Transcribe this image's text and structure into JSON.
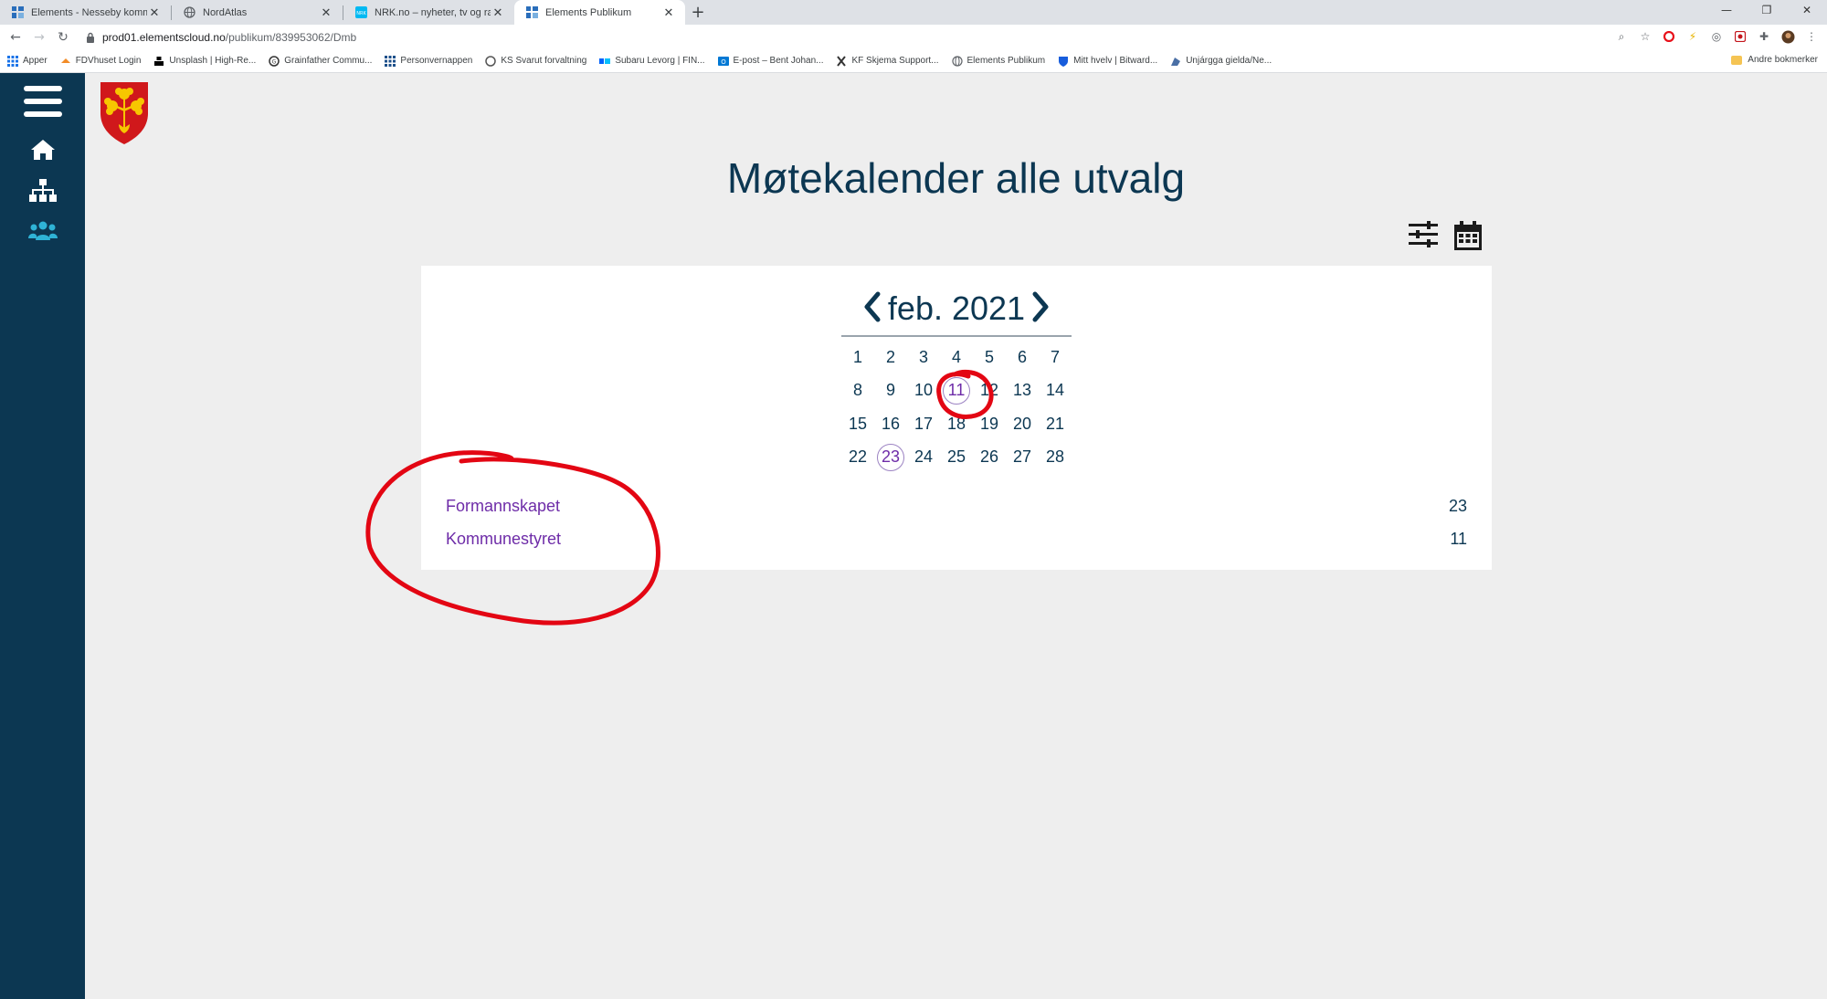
{
  "browser": {
    "tabs": [
      {
        "title": "Elements - Nesseby kommune",
        "active": false,
        "favicon": "elements-icon"
      },
      {
        "title": "NordAtlas",
        "active": false,
        "favicon": "globe-icon"
      },
      {
        "title": "NRK.no – nyheter, tv og radio fra",
        "active": false,
        "favicon": "nrk-icon"
      },
      {
        "title": "Elements Publikum",
        "active": true,
        "favicon": "elements-icon"
      }
    ],
    "url_host": "prod01.elementscloud.no",
    "url_path": "/publikum/839953062/Dmb",
    "bookmarks": [
      "Apper",
      "FDVhuset Login",
      "Unsplash | High-Re...",
      "Grainfather Commu...",
      "Personvernappen",
      "KS Svarut forvaltning",
      "Subaru Levorg | FIN...",
      "E-post – Bent Johan...",
      "KF Skjema Support...",
      "Elements Publikum",
      "Mitt hvelv | Bitward...",
      "Unjárgga gielda/Ne..."
    ],
    "other_bookmarks": "Andre bokmerker"
  },
  "page": {
    "title": "Møtekalender alle utvalg",
    "month_label": "feb. 2021",
    "days": [
      1,
      2,
      3,
      4,
      5,
      6,
      7,
      8,
      9,
      10,
      11,
      12,
      13,
      14,
      15,
      16,
      17,
      18,
      19,
      20,
      21,
      22,
      23,
      24,
      25,
      26,
      27,
      28
    ],
    "meeting_days": [
      11,
      23
    ],
    "events": [
      {
        "name": "Formannskapet",
        "day": "23"
      },
      {
        "name": "Kommunestyret",
        "day": "11"
      }
    ]
  },
  "colors": {
    "sidebar": "#0c3752",
    "accent_purple": "#6e2ca8",
    "annotation_red": "#e30613"
  }
}
